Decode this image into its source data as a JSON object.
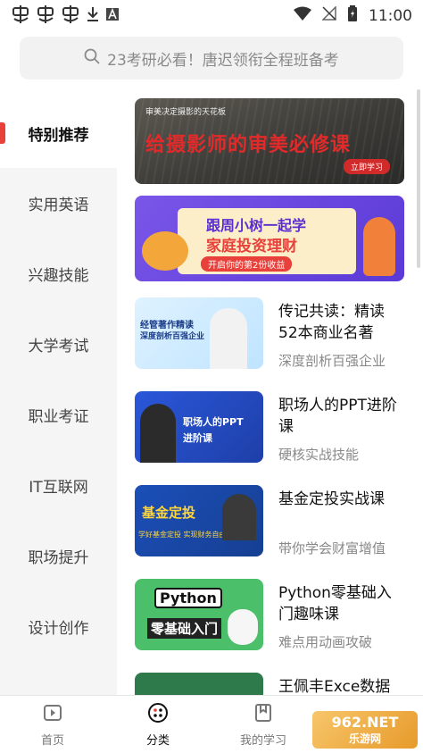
{
  "status_bar": {
    "time": "11:00"
  },
  "search": {
    "placeholder": "23考研必看！唐迟领衔全程班备考"
  },
  "sidebar": {
    "items": [
      {
        "label": "特别推荐",
        "active": true
      },
      {
        "label": "实用英语"
      },
      {
        "label": "兴趣技能"
      },
      {
        "label": "大学考试"
      },
      {
        "label": "职业考证"
      },
      {
        "label": "IT互联网"
      },
      {
        "label": "职场提升"
      },
      {
        "label": "设计创作"
      }
    ]
  },
  "banners": [
    {
      "tag": "审美决定摄影的天花板",
      "title": "给摄影师的审美必修课",
      "button": "立即学习"
    },
    {
      "title1": "跟周小树一起学",
      "title2": "家庭投资理财",
      "subtitle": "开启你的第2份收益"
    }
  ],
  "courses": [
    {
      "title": "传记共读：精读52本商业名著",
      "subtitle": "深度剖析百强企业",
      "thumb_line1": "经管著作精读",
      "thumb_line2": "深度剖析百强企业"
    },
    {
      "title": "职场人的PPT进阶课",
      "subtitle": "硬核实战技能",
      "thumb_line1": "职场人的PPT",
      "thumb_line2": "进阶课"
    },
    {
      "title": "基金定投实战课",
      "subtitle": "带你学会财富增值",
      "thumb_line1": "基金定投",
      "thumb_line2": "学好基金定投 实现财务自由"
    },
    {
      "title": "Python零基础入门趣味课",
      "subtitle": "难点用动画攻破",
      "thumb_line1": "Python",
      "thumb_line2": "零基础入门"
    },
    {
      "title": "王佩丰Exce数据"
    }
  ],
  "tabbar": {
    "items": [
      {
        "label": "首页",
        "icon": "home-play-icon"
      },
      {
        "label": "分类",
        "icon": "category-icon",
        "active": true
      },
      {
        "label": "我的学习",
        "icon": "bookmark-icon"
      }
    ]
  },
  "watermark": {
    "line1": "962.NET",
    "line2": "乐游网"
  },
  "colors": {
    "accent": "#e8403a",
    "sidebar_bg": "#f5f5f5"
  }
}
